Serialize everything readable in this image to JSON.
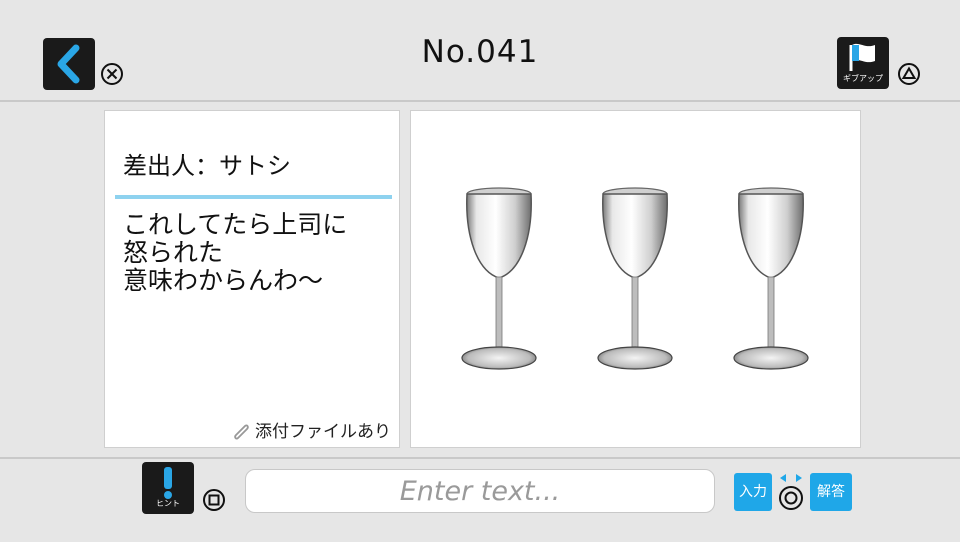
{
  "header": {
    "title": "No.041",
    "back_icon": "chevron-left-icon",
    "back_shortcut": "cross-symbol",
    "giveup_label": "ギブアップ",
    "giveup_icon": "flag-icon",
    "giveup_shortcut": "triangle-symbol"
  },
  "message": {
    "sender": "差出人：サトシ",
    "body": "これしてたら上司に\n怒られた\n意味わからんわ〜",
    "attachment_label": "添付ファイルあり",
    "attachment_icon": "paperclip-icon"
  },
  "image": {
    "icon": "wine-glasses-icon"
  },
  "footer": {
    "hint_label": "ヒント",
    "hint_icon": "exclamation-icon",
    "hint_shortcut": "square-symbol",
    "input_placeholder": "Enter text...",
    "input_button_label": "入力",
    "answer_button_label": "解答",
    "answer_shortcut": "circle-symbol",
    "accent_color": "#1fa7e8",
    "divider_color": "#8ed2ef"
  }
}
